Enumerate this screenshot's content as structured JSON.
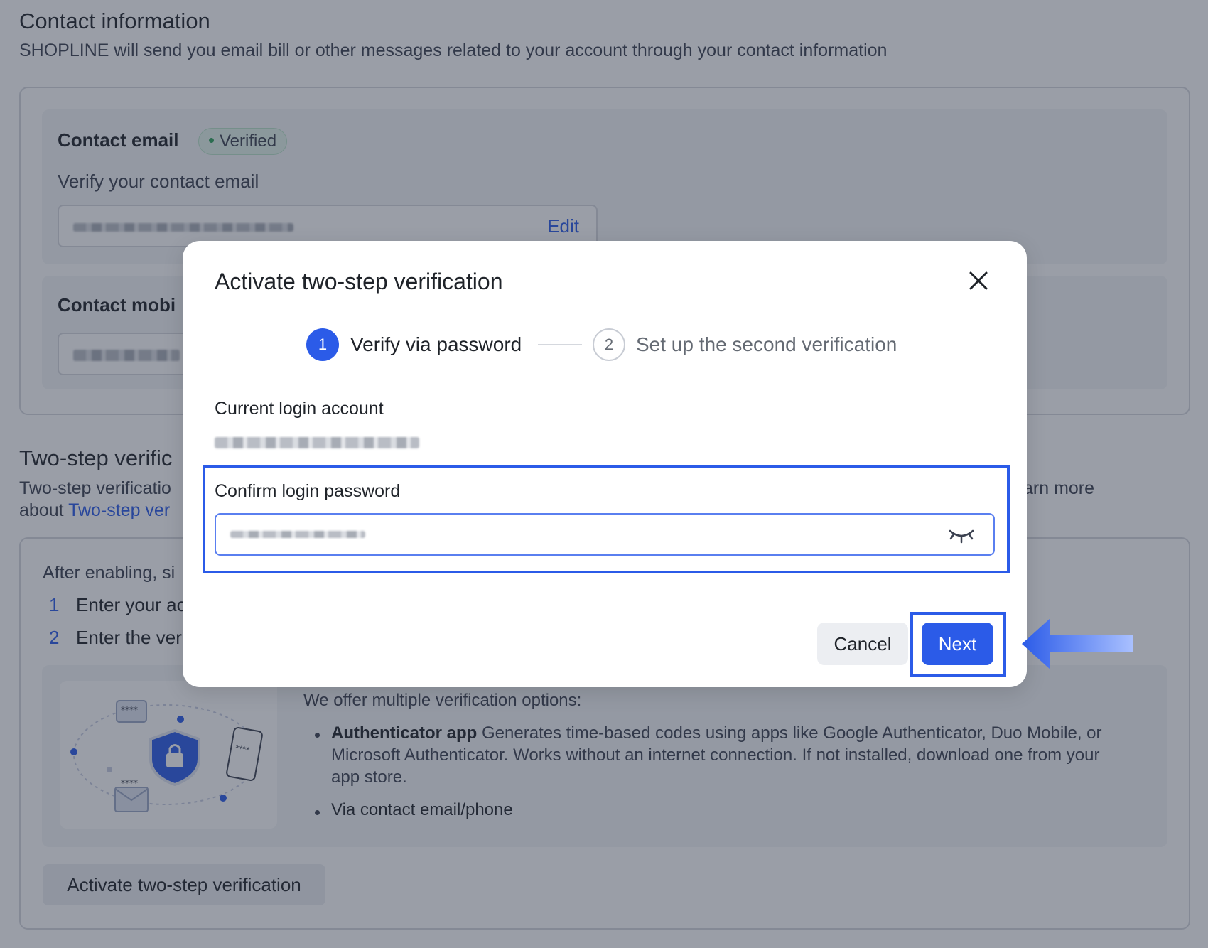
{
  "contact": {
    "title": "Contact information",
    "description": "SHOPLINE will send you email bill or other messages related to your account through your contact information",
    "email_label": "Contact email",
    "email_badge": "Verified",
    "email_hint": "Verify your contact email",
    "edit_label": "Edit",
    "mobile_label": "Contact mobi"
  },
  "two_step": {
    "title": "Two-step verific",
    "desc_line1_start": "Two-step verificatio",
    "desc_line1_end": "arn more",
    "desc_line2_prefix": "about ",
    "desc_link": "Two-step ver",
    "after_enabling": "After enabling, si",
    "steps": [
      {
        "num": "1",
        "text": "Enter your ac"
      },
      {
        "num": "2",
        "text": "Enter the veri"
      }
    ],
    "options_intro": "We offer multiple verification options:",
    "option1_title": "Authenticator app",
    "option1_desc_l1": " Generates time-based codes using apps like Google Authenticator, Duo Mobile, or",
    "option1_desc_l2": "Microsoft Authenticator. Works without an internet connection. If not installed, download one from your",
    "option1_desc_l3": "app store.",
    "option2": "Via contact email/phone",
    "activate_button": "Activate two-step verification"
  },
  "modal": {
    "title": "Activate two-step verification",
    "step1_num": "1",
    "step1_label": "Verify via password",
    "step2_num": "2",
    "step2_label": "Set up the second verification",
    "account_label": "Current login account",
    "password_label": "Confirm login password",
    "cancel": "Cancel",
    "next": "Next"
  },
  "icons": {
    "close": "close-icon",
    "eye": "eye-closed-icon",
    "arrow": "arrow-left-icon",
    "illustration": "shield-lock-illustration"
  },
  "colors": {
    "primary": "#2b5be8",
    "verified": "#2fa35c",
    "overlay": "rgba(40,48,68,0.47)"
  }
}
